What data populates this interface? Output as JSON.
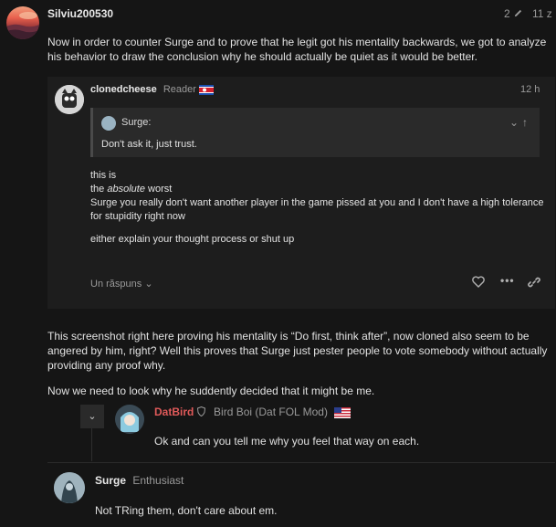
{
  "post": {
    "username": "Silviu200530",
    "edit_count": "2",
    "time": "11 z",
    "intro_text": "Now in order to counter Surge and to prove that he legit got his mentality backwards, we got to analyze his behavior to draw the conclusion why he should actually be quiet as it would be better.",
    "quote": {
      "username": "clonedcheese",
      "title": "Reader",
      "time": "12 h",
      "inner_quote_author": "Surge:",
      "inner_quote_text": "Don't ask it, just trust.",
      "lines": [
        "this is",
        "the ",
        "absolute",
        " worst",
        "Surge you really don't want another player in the game pissed at you and I don't have a high tolerance for stupidity right now",
        "either explain your thought process or shut up"
      ],
      "replies_label": "Un răspuns"
    },
    "body_text_1": "This screenshot right here proving his mentality is “Do first, think after”, now cloned also seem to be angered by him, right? Well this proves that Surge just pester people to vote somebody without actually providing any proof why.",
    "body_text_2": "Now we need to look why he suddently decided that it might be me.",
    "reply": {
      "username": "DatBird",
      "title": "Bird Boi (Dat FOL Mod)",
      "text": "Ok and can you tell me why you feel that way on each."
    },
    "next": {
      "username": "Surge",
      "title": "Enthusiast",
      "text": "Not TRing them, don't care about em."
    }
  },
  "colors": {
    "background": "#151515",
    "card": "#1d1d1d",
    "datbird_name": "#e05a5a"
  },
  "icons": [
    "pencil-icon",
    "chevron-down-icon",
    "chevron-up-icon",
    "heart-icon",
    "more-icon",
    "link-icon",
    "shield-icon"
  ]
}
